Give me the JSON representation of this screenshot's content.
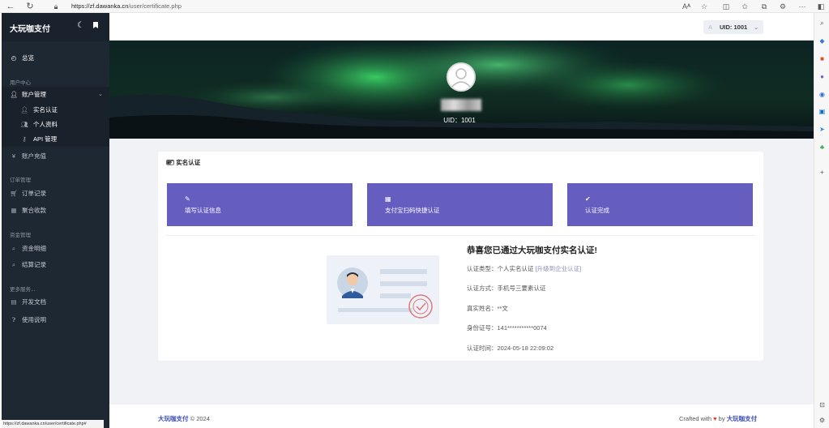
{
  "browser": {
    "url_prefix": "https://",
    "url_host": "zf.dawanka.cn",
    "url_path": "/user/certificate.php",
    "icons": [
      "back-icon",
      "refresh-icon",
      "lock-icon",
      "read-aloud-icon",
      "favorite-icon",
      "split-icon",
      "favorites-icon",
      "collections-icon",
      "extensions-icon",
      "more-icon",
      "sidebar-toggle-icon"
    ]
  },
  "sidebar": {
    "brand": "大玩咖支付",
    "overview": "总览",
    "sec_user": "用户中心",
    "account": "账户管理",
    "sub_realname": "实名认证",
    "sub_profile": "个人资料",
    "sub_api": "API 管理",
    "recharge": "账户充值",
    "sec_order": "订单管理",
    "orders": "订单记录",
    "aggregate": "聚合收款",
    "sec_fund": "资金管理",
    "fund_detail": "资金明细",
    "settle": "结算记录",
    "sec_more": "更多服务...",
    "docs": "开发文档",
    "help": "使用说明",
    "status_url": "https://zf.dawanka.cn/user/certificate.php#"
  },
  "header": {
    "uid_label": "UID: 1001",
    "uid_prefix": "A"
  },
  "hero": {
    "uid": "UID：1001"
  },
  "card": {
    "title": "实名认证",
    "step1": "填写认证信息",
    "step2": "支付宝扫码快捷认证",
    "step3": "认证完成",
    "congrats": "恭喜您已通过大玩咖支付实名认证!",
    "type_label": "认证类型：个人实名认证",
    "upgrade": "[升级到企业认证]",
    "method": "认证方式：手机号三要素认证",
    "name": "真实姓名：**文",
    "idno": "身份证号：141***********0074",
    "time": "认证时间：2024-05-18 22:09:02"
  },
  "footer": {
    "brand": "大玩咖支付",
    "year": "© 2024",
    "crafted": "Crafted with",
    "by": "by",
    "brand2": "大玩咖支付"
  },
  "colors": {
    "accent": "#655dc0",
    "sidebar": "#1e2833",
    "brand_link": "#3c4fb8"
  }
}
